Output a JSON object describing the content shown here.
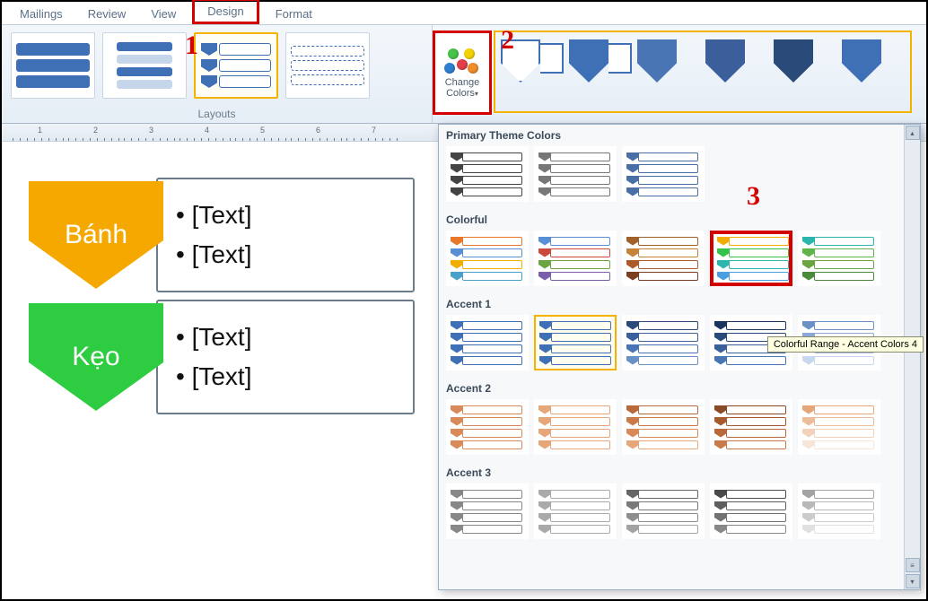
{
  "tabs": {
    "mailings": "Mailings",
    "review": "Review",
    "view": "View",
    "design": "Design",
    "format": "Format"
  },
  "ribbon": {
    "layouts_label": "Layouts",
    "change_colors_l1": "Change",
    "change_colors_l2": "Colors"
  },
  "annotations": {
    "one": "1",
    "two": "2",
    "three": "3"
  },
  "dropdown": {
    "h_primary": "Primary Theme Colors",
    "h_colorful": "Colorful",
    "h_accent1": "Accent 1",
    "h_accent2": "Accent 2",
    "h_accent3": "Accent 3",
    "tooltip": "Colorful Range - Accent Colors 4"
  },
  "smartart": {
    "row1_label": "Bánh",
    "row2_label": "Kẹo",
    "bullet": "• [Text]"
  },
  "ruler_numbers": [
    "1",
    "2",
    "3",
    "4",
    "5",
    "6",
    "7"
  ],
  "color_schemes": {
    "primary": [
      [
        "#444",
        "#444",
        "#444",
        "#444"
      ],
      [
        "#777",
        "#777",
        "#777",
        "#777"
      ],
      [
        "#4a6fa5",
        "#4a6fa5",
        "#4a6fa5",
        "#4a6fa5"
      ]
    ],
    "colorful": [
      [
        "#e8772a",
        "#5a8fd6",
        "#f2ae00",
        "#4aa0c8"
      ],
      [
        "#5a8fd6",
        "#c94a3b",
        "#6aa443",
        "#7a5fa8"
      ],
      [
        "#a0612a",
        "#c5833a",
        "#ad5a2a",
        "#7a3f20"
      ],
      [
        "#f2ae00",
        "#35c24a",
        "#2cb5ad",
        "#4a9fe0"
      ],
      [
        "#2cb5ad",
        "#5fb54a",
        "#6aa443",
        "#4a8a3a"
      ]
    ],
    "accent1": [
      [
        "#3f6fb5",
        "#3f6fb5",
        "#3f6fb5",
        "#3f6fb5"
      ],
      [
        "#3f6fb5",
        "#3f6fb5",
        "#3f6fb5",
        "#3f6fb5"
      ],
      [
        "#2a4a7a",
        "#3a5f9a",
        "#4a75b5",
        "#6a90c5"
      ],
      [
        "#1a355f",
        "#2a4a7a",
        "#3a5f9a",
        "#4a75b5"
      ],
      [
        "#6a90c5",
        "#8aaad5",
        "#aac2e2",
        "#c8d8ee"
      ]
    ],
    "accent2": [
      [
        "#d98a5a",
        "#d98a5a",
        "#d98a5a",
        "#d98a5a"
      ],
      [
        "#e5a77a",
        "#e5a77a",
        "#e5a77a",
        "#e5a77a"
      ],
      [
        "#b86a3a",
        "#c97a4a",
        "#d98a5a",
        "#e5a77a"
      ],
      [
        "#8a4a25",
        "#a55a30",
        "#b86a3a",
        "#c97a4a"
      ],
      [
        "#e5a77a",
        "#ecbd9a",
        "#f2d2ba",
        "#f7e5d8"
      ]
    ],
    "accent3": [
      [
        "#888",
        "#888",
        "#888",
        "#888"
      ],
      [
        "#aaa",
        "#aaa",
        "#aaa",
        "#aaa"
      ],
      [
        "#666",
        "#7a7a7a",
        "#8e8e8e",
        "#a3a3a3"
      ],
      [
        "#4a4a4a",
        "#5e5e5e",
        "#727272",
        "#888"
      ],
      [
        "#a3a3a3",
        "#b8b8b8",
        "#ccc",
        "#e0e0e0"
      ]
    ]
  }
}
